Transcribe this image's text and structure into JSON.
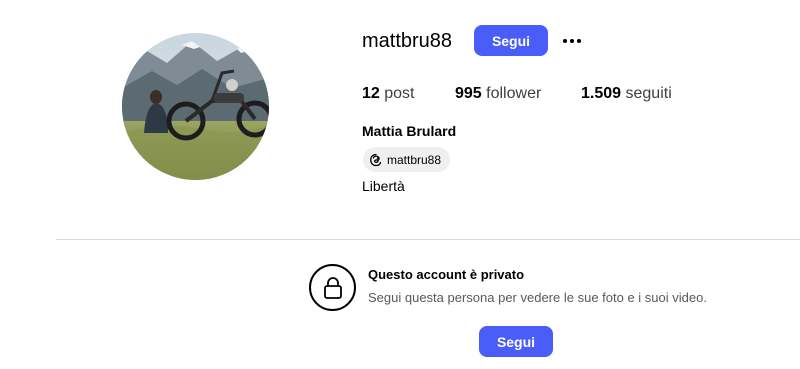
{
  "profile": {
    "username": "mattbru88",
    "follow_label": "Segui",
    "more_icon": "more-horizontal-icon",
    "stats": {
      "posts_count": "12",
      "posts_label": "post",
      "followers_count": "995",
      "followers_label": "follower",
      "following_count": "1.509",
      "following_label": "seguiti"
    },
    "full_name": "Mattia Brulard",
    "threads_handle": "mattbru88",
    "threads_icon": "threads-icon",
    "bio": "Libertà",
    "avatar_icon": "profile-photo"
  },
  "private_notice": {
    "icon": "lock-icon",
    "title": "Questo account è privato",
    "subtitle": "Segui questa persona per vedere le sue foto e i suoi video.",
    "follow_label": "Segui"
  },
  "colors": {
    "accent": "#4a5df9",
    "divider": "#dbdbdb",
    "chip_bg": "#efefef"
  }
}
